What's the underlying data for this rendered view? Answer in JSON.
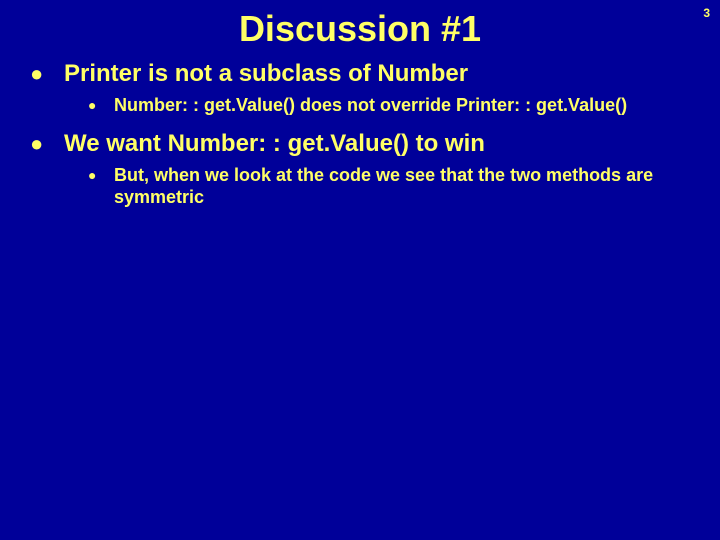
{
  "page_number": "3",
  "title": "Discussion #1",
  "bullets": [
    {
      "text": "Printer is not a subclass of Number",
      "children": [
        {
          "text": "Number: : get.Value() does not override Printer: : get.Value()"
        }
      ]
    },
    {
      "text": "We want Number: : get.Value()  to win",
      "children": [
        {
          "text": "But, when we look at the code we see that the two methods are symmetric"
        }
      ]
    }
  ]
}
